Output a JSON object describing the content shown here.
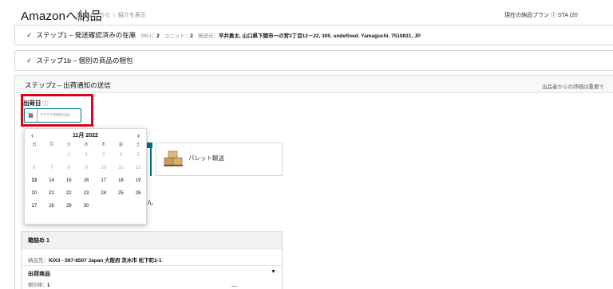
{
  "header": {
    "title": "Amazonへ納品",
    "links": [
      "詳細はこちら",
      "紹介を表示"
    ],
    "plan_label": "現在の納品プラン ⓘ STA (20"
  },
  "step1": {
    "title": "ステップ1 – 発送確認済みの在庫",
    "sku_label": "SKU：",
    "sku_value": "2",
    "unit_label": "ユニット：",
    "unit_value": "2",
    "origin_label": "発送元：",
    "origin_value": "平井勇太, 山口県下関市一の宮3丁目12－22, 305.  undefined.  Yamaguchi.  7510831, JP"
  },
  "step1b": {
    "title": "ステップ1b – 個別の商品の梱包"
  },
  "step2": {
    "title": "ステップ2 – 出荷通知の送信",
    "right_text": "出品者からの評価は重要で",
    "ship_date_label": "出荷日",
    "date_placeholder": "YYYY/MM/DD"
  },
  "calendar": {
    "month": "11月 2022",
    "weekdays": [
      "日",
      "月",
      "火",
      "水",
      "木",
      "金",
      "土"
    ],
    "days": [
      "",
      "",
      "1",
      "2",
      "3",
      "4",
      "5",
      "6",
      "7",
      "8",
      "9",
      "10",
      "11",
      "12",
      "13",
      "14",
      "15",
      "16",
      "17",
      "18",
      "19",
      "20",
      "21",
      "22",
      "23",
      "24",
      "25",
      "26",
      "27",
      "28",
      "29",
      "30"
    ],
    "today": "13"
  },
  "shipping_options": {
    "pallet_label": "パレット輸送",
    "truncated_text": "ん"
  },
  "box_panel": {
    "header": "箱詰め 1",
    "dest_label": "納品先：",
    "dest_value": "KIX3 - 567-8507 Japan 大阪府 茨木市 松下町2-1",
    "items_label": "出荷商品",
    "box_count_label": "梱包箱：",
    "box_count_value": "1"
  },
  "colors": {
    "accent": "#007185",
    "highlight": "#e0001b",
    "border": "#d5d9d9"
  }
}
